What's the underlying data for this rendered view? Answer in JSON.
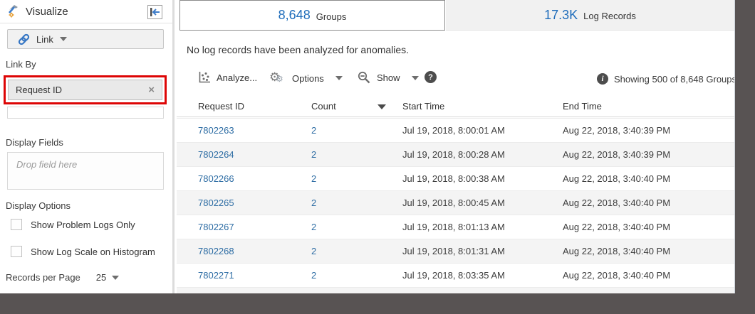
{
  "colors": {
    "accent_blue": "#1f6dbb",
    "link_blue": "#2e6da4",
    "annotation_red": "#dd0505",
    "dark_frame": "#585353",
    "inactive_tab_bg": "#f1f1f1"
  },
  "sidebar": {
    "title": "Visualize",
    "link_button": {
      "label": "Link"
    },
    "link_by": {
      "label": "Link By",
      "field": "Request ID"
    },
    "display_fields": {
      "label": "Display Fields",
      "placeholder": "Drop field here"
    },
    "display_options": {
      "label": "Display Options",
      "checkboxes": [
        {
          "label": "Show Problem Logs Only",
          "checked": false
        },
        {
          "label": "Show Log Scale on Histogram",
          "checked": false
        }
      ]
    },
    "records_per_page": {
      "label": "Records per Page",
      "value": "25"
    }
  },
  "tabs": [
    {
      "count": "8,648",
      "label": "Groups",
      "active": true
    },
    {
      "count": "17.3K",
      "label": "Log Records",
      "active": false
    }
  ],
  "message": "No log records have been analyzed for anomalies.",
  "toolbar": {
    "analyze_label": "Analyze...",
    "options_label": "Options",
    "show_label": "Show",
    "summary": "Showing 500 of 8,648 Groups"
  },
  "icons": {
    "help_glyph": "?",
    "info_glyph": "i",
    "gear_glyph": "⚙",
    "close_glyph": "×"
  },
  "table": {
    "columns": [
      "Request ID",
      "Count",
      "Start Time",
      "End Time"
    ],
    "sorted_column": "Count",
    "sort_direction": "descending",
    "rows": [
      {
        "request_id": "7802263",
        "count": "2",
        "start": "Jul 19, 2018, 8:00:01 AM",
        "end": "Aug 22, 2018, 3:40:39 PM"
      },
      {
        "request_id": "7802264",
        "count": "2",
        "start": "Jul 19, 2018, 8:00:28 AM",
        "end": "Aug 22, 2018, 3:40:39 PM"
      },
      {
        "request_id": "7802266",
        "count": "2",
        "start": "Jul 19, 2018, 8:00:38 AM",
        "end": "Aug 22, 2018, 3:40:40 PM"
      },
      {
        "request_id": "7802265",
        "count": "2",
        "start": "Jul 19, 2018, 8:00:45 AM",
        "end": "Aug 22, 2018, 3:40:40 PM"
      },
      {
        "request_id": "7802267",
        "count": "2",
        "start": "Jul 19, 2018, 8:01:13 AM",
        "end": "Aug 22, 2018, 3:40:40 PM"
      },
      {
        "request_id": "7802268",
        "count": "2",
        "start": "Jul 19, 2018, 8:01:31 AM",
        "end": "Aug 22, 2018, 3:40:40 PM"
      },
      {
        "request_id": "7802271",
        "count": "2",
        "start": "Jul 19, 2018, 8:03:35 AM",
        "end": "Aug 22, 2018, 3:40:40 PM"
      }
    ]
  }
}
